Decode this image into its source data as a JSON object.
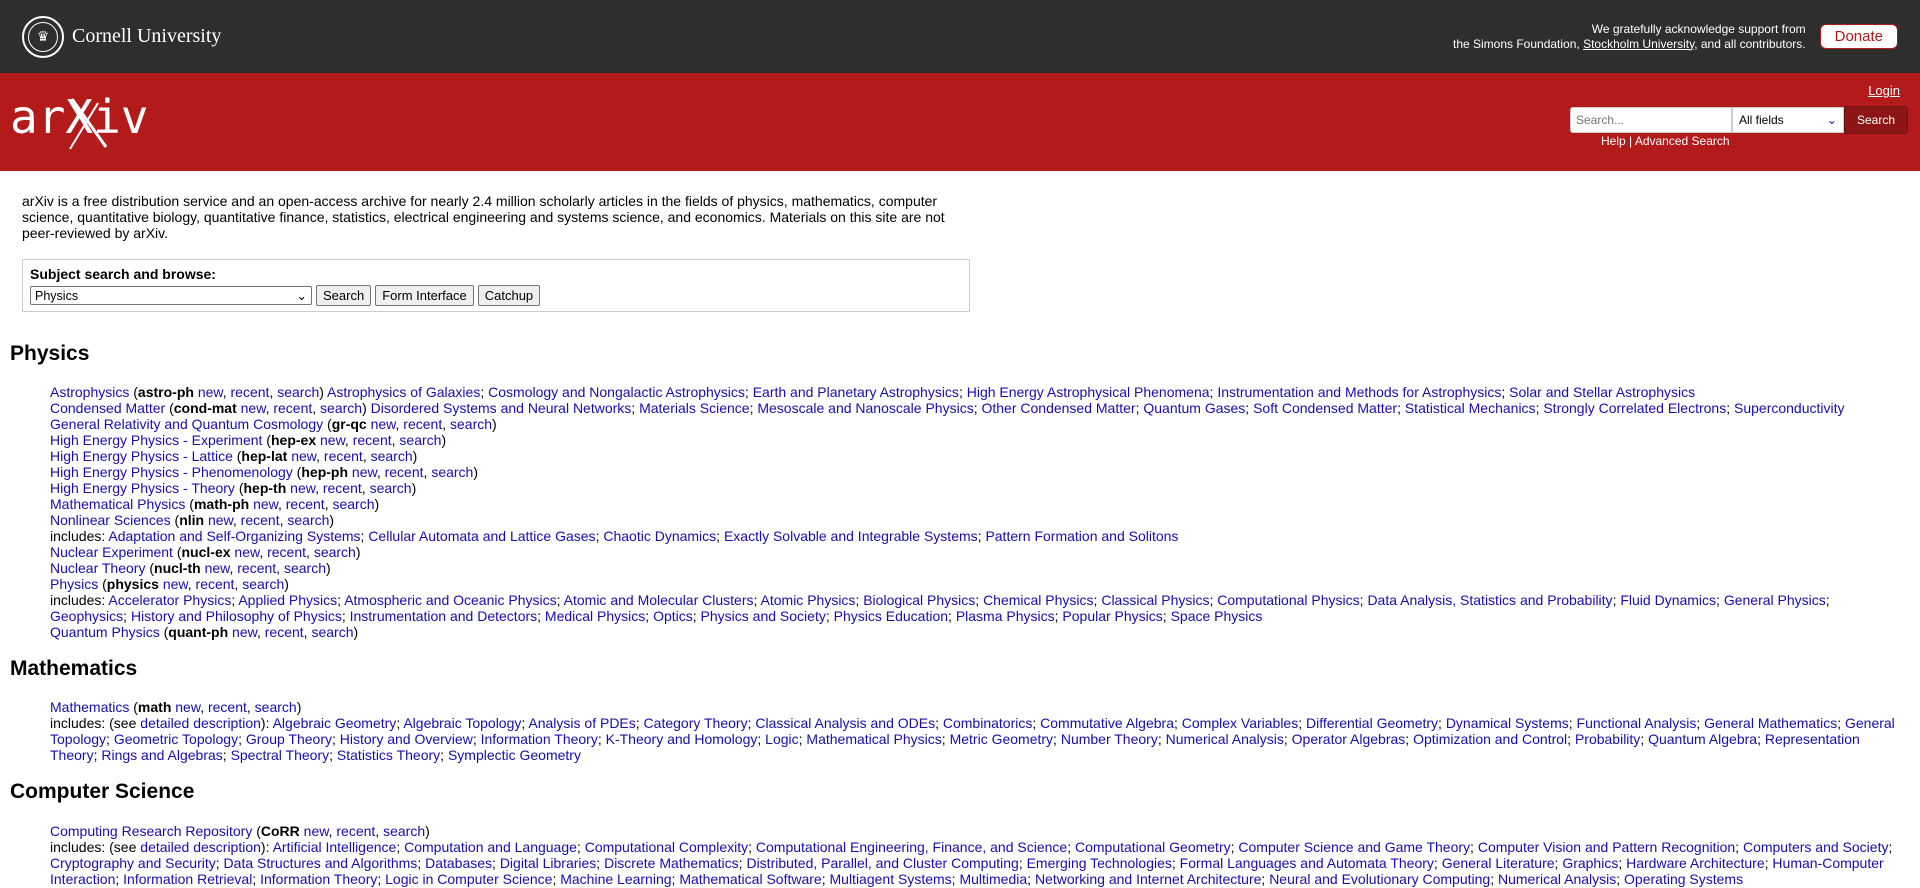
{
  "top": {
    "institution": "Cornell University",
    "ack_line1": "We gratefully acknowledge support from",
    "ack_line2_pre": "the Simons Foundation,",
    "ack_link": "Stockholm University",
    "ack_line2_post": ", and all contributors.",
    "donate": "Donate"
  },
  "header": {
    "logo": "arXiv",
    "login": "Login",
    "search_placeholder": "Search...",
    "field_select": "All fields",
    "search_button": "Search",
    "help": "Help",
    "sep": "|",
    "advanced": "Advanced Search"
  },
  "intro": "arXiv is a free distribution service and an open-access archive for nearly 2.4 million scholarly articles in the fields of physics, mathematics, computer science, quantitative biology, quantitative finance, statistics, electrical engineering and systems science, and economics. Materials on this site are not peer-reviewed by arXiv.",
  "subject": {
    "label": "Subject search and browse:",
    "selected": "Physics",
    "search": "Search",
    "form": "Form Interface",
    "catchup": "Catchup"
  },
  "colors": {
    "topbar": "#2e2e2e",
    "redbar": "#b31b1b",
    "link": "#1a0dab"
  },
  "sections": [
    {
      "title": "Physics",
      "items": [
        {
          "name": "Astrophysics",
          "code": "astro-ph",
          "includes": [
            "Astrophysics of Galaxies",
            "Cosmology and Nongalactic Astrophysics",
            "Earth and Planetary Astrophysics",
            "High Energy Astrophysical Phenomena",
            "Instrumentation and Methods for Astrophysics",
            "Solar and Stellar Astrophysics"
          ],
          "inline": true
        },
        {
          "name": "Condensed Matter",
          "code": "cond-mat",
          "includes": [
            "Disordered Systems and Neural Networks",
            "Materials Science",
            "Mesoscale and Nanoscale Physics",
            "Other Condensed Matter",
            "Quantum Gases",
            "Soft Condensed Matter",
            "Statistical Mechanics",
            "Strongly Correlated Electrons",
            "Superconductivity"
          ],
          "inline": true
        },
        {
          "name": "General Relativity and Quantum Cosmology",
          "code": "gr-qc",
          "includes": []
        },
        {
          "name": "High Energy Physics - Experiment",
          "code": "hep-ex",
          "includes": []
        },
        {
          "name": "High Energy Physics - Lattice",
          "code": "hep-lat",
          "includes": []
        },
        {
          "name": "High Energy Physics - Phenomenology",
          "code": "hep-ph",
          "includes": []
        },
        {
          "name": "High Energy Physics - Theory",
          "code": "hep-th",
          "includes": []
        },
        {
          "name": "Mathematical Physics",
          "code": "math-ph",
          "includes": []
        },
        {
          "name": "Nonlinear Sciences",
          "code": "nlin",
          "includes": [
            "Adaptation and Self-Organizing Systems",
            "Cellular Automata and Lattice Gases",
            "Chaotic Dynamics",
            "Exactly Solvable and Integrable Systems",
            "Pattern Formation and Solitons"
          ]
        },
        {
          "name": "Nuclear Experiment",
          "code": "nucl-ex",
          "includes": []
        },
        {
          "name": "Nuclear Theory",
          "code": "nucl-th",
          "includes": []
        },
        {
          "name": "Physics",
          "code": "physics",
          "includes": [
            "Accelerator Physics",
            "Applied Physics",
            "Atmospheric and Oceanic Physics",
            "Atomic and Molecular Clusters",
            "Atomic Physics",
            "Biological Physics",
            "Chemical Physics",
            "Classical Physics",
            "Computational Physics",
            "Data Analysis, Statistics and Probability",
            "Fluid Dynamics",
            "General Physics",
            "Geophysics",
            "History and Philosophy of Physics",
            "Instrumentation and Detectors",
            "Medical Physics",
            "Optics",
            "Physics and Society",
            "Physics Education",
            "Plasma Physics",
            "Popular Physics",
            "Space Physics"
          ]
        },
        {
          "name": "Quantum Physics",
          "code": "quant-ph",
          "includes": []
        }
      ]
    },
    {
      "title": "Mathematics",
      "items": [
        {
          "name": "Mathematics",
          "code": "math",
          "detailed": true,
          "includes": [
            "Algebraic Geometry",
            "Algebraic Topology",
            "Analysis of PDEs",
            "Category Theory",
            "Classical Analysis and ODEs",
            "Combinatorics",
            "Commutative Algebra",
            "Complex Variables",
            "Differential Geometry",
            "Dynamical Systems",
            "Functional Analysis",
            "General Mathematics",
            "General Topology",
            "Geometric Topology",
            "Group Theory",
            "History and Overview",
            "Information Theory",
            "K-Theory and Homology",
            "Logic",
            "Mathematical Physics",
            "Metric Geometry",
            "Number Theory",
            "Numerical Analysis",
            "Operator Algebras",
            "Optimization and Control",
            "Probability",
            "Quantum Algebra",
            "Representation Theory",
            "Rings and Algebras",
            "Spectral Theory",
            "Statistics Theory",
            "Symplectic Geometry"
          ]
        }
      ]
    },
    {
      "title": "Computer Science",
      "items": [
        {
          "name": "Computing Research Repository",
          "code": "CoRR",
          "detailed": true,
          "includes": [
            "Artificial Intelligence",
            "Computation and Language",
            "Computational Complexity",
            "Computational Engineering, Finance, and Science",
            "Computational Geometry",
            "Computer Science and Game Theory",
            "Computer Vision and Pattern Recognition",
            "Computers and Society",
            "Cryptography and Security",
            "Data Structures and Algorithms",
            "Databases",
            "Digital Libraries",
            "Discrete Mathematics",
            "Distributed, Parallel, and Cluster Computing",
            "Emerging Technologies",
            "Formal Languages and Automata Theory",
            "General Literature",
            "Graphics",
            "Hardware Architecture",
            "Human-Computer Interaction",
            "Information Retrieval",
            "Information Theory",
            "Logic in Computer Science",
            "Machine Learning",
            "Mathematical Software",
            "Multiagent Systems",
            "Multimedia",
            "Networking and Internet Architecture",
            "Neural and Evolutionary Computing",
            "Numerical Analysis",
            "Operating Systems"
          ]
        }
      ]
    }
  ],
  "labels": {
    "new": "new",
    "recent": "recent",
    "search": "search",
    "includes": "includes:",
    "includes_see": "includes: (see",
    "detailed": "detailed description"
  }
}
